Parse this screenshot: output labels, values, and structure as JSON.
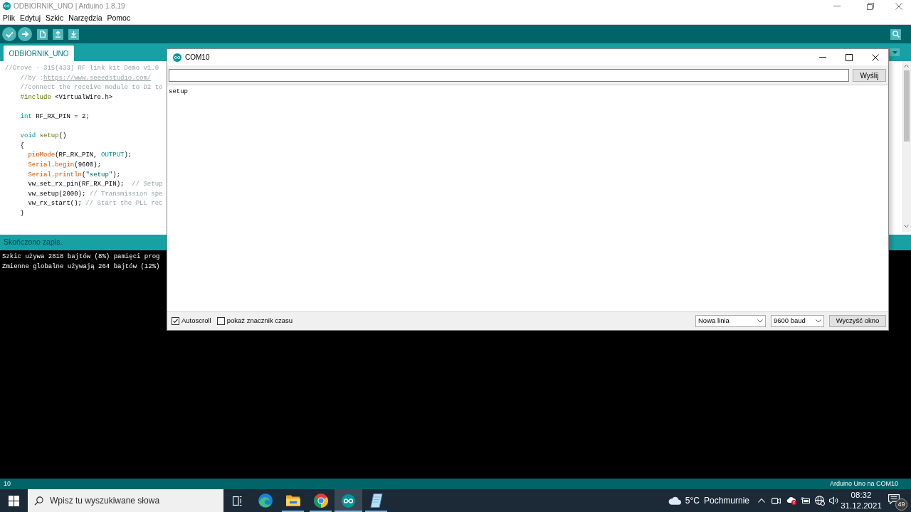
{
  "window": {
    "title": "ODBIORNIK_UNO | Arduino 1.8.19"
  },
  "menu": [
    {
      "label": "Plik"
    },
    {
      "label": "Edytuj"
    },
    {
      "label": "Szkic"
    },
    {
      "label": "Narzędzia"
    },
    {
      "label": "Pomoc"
    }
  ],
  "tabs": [
    {
      "label": "ODBIORNIK_UNO",
      "selected": true
    }
  ],
  "editor": {
    "blocks": [
      {
        "lines": [
          {
            "tokens": [
              {
                "kind": "comment",
                "text": "//Grove - 315(433) RF link kit Demo v1.0"
              }
            ]
          },
          {
            "tokens": [
              {
                "kind": "comment",
                "text": "    //by :"
              },
              {
                "kind": "link",
                "text": "https://www.seeedstudio.com/"
              }
            ]
          },
          {
            "tokens": [
              {
                "kind": "comment",
                "text": "    //connect the receive module to D2 to"
              }
            ]
          },
          {
            "tokens": [
              {
                "kind": "directive",
                "text": "    #include"
              },
              {
                "kind": "plain",
                "text": " <VirtualWire.h>"
              }
            ]
          }
        ]
      },
      {
        "lines": [
          {
            "tokens": [
              {
                "kind": "type",
                "text": "    int"
              },
              {
                "kind": "plain",
                "text": " RF_RX_PIN = 2;"
              }
            ]
          }
        ]
      },
      {
        "lines": [
          {
            "tokens": [
              {
                "kind": "type",
                "text": "    void "
              },
              {
                "kind": "name",
                "text": "setup"
              },
              {
                "kind": "plain",
                "text": "()"
              }
            ]
          },
          {
            "tokens": [
              {
                "kind": "plain",
                "text": "    {"
              }
            ]
          },
          {
            "tokens": [
              {
                "kind": "func",
                "text": "      pinMode"
              },
              {
                "kind": "plain",
                "text": "(RF_RX_PIN, "
              },
              {
                "kind": "constant",
                "text": "OUTPUT"
              },
              {
                "kind": "plain",
                "text": ");"
              }
            ]
          },
          {
            "tokens": [
              {
                "kind": "func",
                "text": "      Serial"
              },
              {
                "kind": "plain",
                "text": "."
              },
              {
                "kind": "func",
                "text": "begin"
              },
              {
                "kind": "plain",
                "text": "(9600);"
              }
            ]
          },
          {
            "tokens": [
              {
                "kind": "func",
                "text": "      Serial"
              },
              {
                "kind": "plain",
                "text": "."
              },
              {
                "kind": "func",
                "text": "println"
              },
              {
                "kind": "plain",
                "text": "("
              },
              {
                "kind": "string",
                "text": "\"setup\""
              },
              {
                "kind": "plain",
                "text": ");"
              }
            ]
          },
          {
            "tokens": [
              {
                "kind": "plain",
                "text": "      vw_set_rx_pin(RF_RX_PIN);  "
              },
              {
                "kind": "comment",
                "text": "// Setup"
              }
            ]
          },
          {
            "tokens": [
              {
                "kind": "plain",
                "text": "      vw_setup(2000); "
              },
              {
                "kind": "comment",
                "text": "// Transmission spe"
              }
            ]
          },
          {
            "tokens": [
              {
                "kind": "plain",
                "text": "      vw_rx_start(); "
              },
              {
                "kind": "comment",
                "text": "// Start the PLL rec"
              }
            ]
          },
          {
            "tokens": [
              {
                "kind": "plain",
                "text": "    }"
              }
            ]
          }
        ]
      }
    ]
  },
  "message": "Skończono zapis.",
  "console": {
    "lines": [
      "Szkic używa 2818 bajtów (8%) pamięci prog",
      "Zmienne globalne używają 264 bajtów (12%)"
    ]
  },
  "status_bar": {
    "line": "10",
    "board": "Arduino Uno na COM10"
  },
  "serial_monitor": {
    "title": "COM10",
    "send_button": "Wyślij",
    "output": [
      "setup"
    ],
    "options": [
      {
        "label": "Autoscroll",
        "checked": true
      },
      {
        "label": "pokaż znacznik czasu",
        "checked": false
      }
    ],
    "line_ending": "Nowa linia",
    "baud_rate": "9600 baud",
    "clear_button": "Wyczyść okno"
  },
  "taskbar": {
    "search": {
      "placeholder": "Wpisz tu wyszukiwane słowa"
    },
    "apps": [
      {
        "running": false,
        "selected": false
      },
      {
        "running": true,
        "selected": false
      },
      {
        "running": true,
        "selected": false
      },
      {
        "running": true,
        "selected": true
      },
      {
        "running": true,
        "selected": false
      }
    ],
    "weather": {
      "temperature": "5°C",
      "condition": "Pochmurnie"
    },
    "clock": {
      "time": "08:32",
      "date": "31.12.2021"
    },
    "notifications": {
      "count": "49"
    }
  }
}
